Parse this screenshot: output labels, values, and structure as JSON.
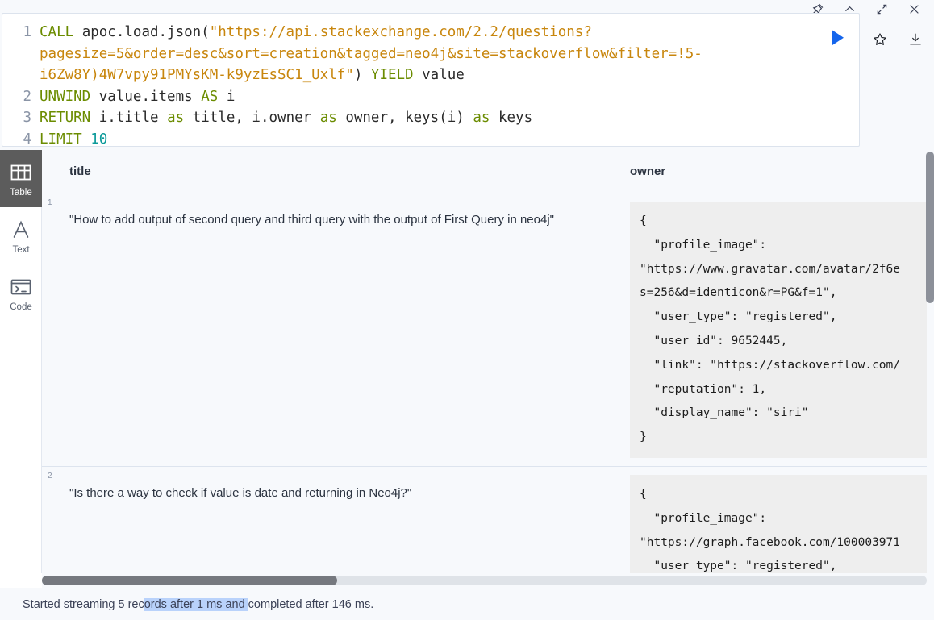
{
  "titlebar": {
    "buttons": [
      {
        "name": "pin-icon",
        "label": "Pin"
      },
      {
        "name": "chevron-up-icon",
        "label": "Collapse"
      },
      {
        "name": "expand-icon",
        "label": "Expand"
      },
      {
        "name": "close-icon",
        "label": "Close"
      }
    ]
  },
  "editor": {
    "lines": [
      {
        "number": "1",
        "segments": [
          {
            "cls": "kw",
            "text": "CALL "
          },
          {
            "cls": "fn",
            "text": "apoc.load.json("
          },
          {
            "cls": "str",
            "text": "\"https://api.stackexchange.com/2.2/questions?"
          }
        ]
      },
      {
        "number": "",
        "segments": [
          {
            "cls": "str",
            "text": "pagesize=5&order=desc&sort=creation&tagged=neo4j&site=stackoverflow&filter=!5-"
          }
        ]
      },
      {
        "number": "",
        "segments": [
          {
            "cls": "str",
            "text": "i6Zw8Y)4W7vpy91PMYsKM-k9yzEsSC1_Uxlf\""
          },
          {
            "cls": "fn",
            "text": ") "
          },
          {
            "cls": "kw",
            "text": "YIELD "
          },
          {
            "cls": "fn",
            "text": "value"
          }
        ]
      },
      {
        "number": "2",
        "segments": [
          {
            "cls": "kw",
            "text": "UNWIND "
          },
          {
            "cls": "fn",
            "text": "value.items "
          },
          {
            "cls": "kw",
            "text": "AS "
          },
          {
            "cls": "fn",
            "text": "i"
          }
        ]
      },
      {
        "number": "3",
        "segments": [
          {
            "cls": "kw",
            "text": "RETURN "
          },
          {
            "cls": "fn",
            "text": "i.title "
          },
          {
            "cls": "kw",
            "text": "as "
          },
          {
            "cls": "fn",
            "text": "title, i.owner "
          },
          {
            "cls": "kw",
            "text": "as "
          },
          {
            "cls": "fn",
            "text": "owner, keys(i) "
          },
          {
            "cls": "kw",
            "text": "as "
          },
          {
            "cls": "fn",
            "text": "keys"
          }
        ]
      },
      {
        "number": "4",
        "segments": [
          {
            "cls": "kw",
            "text": "LIMIT "
          },
          {
            "cls": "num",
            "text": "10"
          }
        ]
      }
    ],
    "run_label": "Run",
    "favorite_label": "Save as favorite",
    "download_label": "Download"
  },
  "rail": {
    "items": [
      {
        "name": "table",
        "label": "Table",
        "icon": "table-icon",
        "active": true
      },
      {
        "name": "text",
        "label": "Text",
        "icon": "text-icon",
        "active": false
      },
      {
        "name": "code",
        "label": "Code",
        "icon": "code-icon",
        "active": false
      }
    ]
  },
  "table": {
    "columns": [
      "title",
      "owner"
    ],
    "rows": [
      {
        "number": "1",
        "title": "\"How to add output of second query and third query with the output of First Query in neo4j\"",
        "owner": "{\n  \"profile_image\":\n\"https://www.gravatar.com/avatar/2f6e\ns=256&d=identicon&r=PG&f=1\",\n  \"user_type\": \"registered\",\n  \"user_id\": 9652445,\n  \"link\": \"https://stackoverflow.com/\n  \"reputation\": 1,\n  \"display_name\": \"siri\"\n}"
      },
      {
        "number": "2",
        "title": "\"Is there a way to check if value is date and returning in Neo4j?\"",
        "owner": "{\n  \"profile_image\":\n\"https://graph.facebook.com/100003971\n  \"user_type\": \"registered\","
      }
    ]
  },
  "status": {
    "before_selection": "Started streaming 5 rec",
    "selected": "ords after 1 ms and ",
    "after_selection": "completed after 146 ms."
  },
  "colors": {
    "accent": "#1565ec",
    "keyword": "#6b8c00",
    "string": "#c8860d",
    "number": "#0c9a9a",
    "selection": "#b9d2fb",
    "rail_active_bg": "#5c5c5c",
    "panel_bg": "#f7f9fc",
    "json_bg": "#eeeeee"
  }
}
